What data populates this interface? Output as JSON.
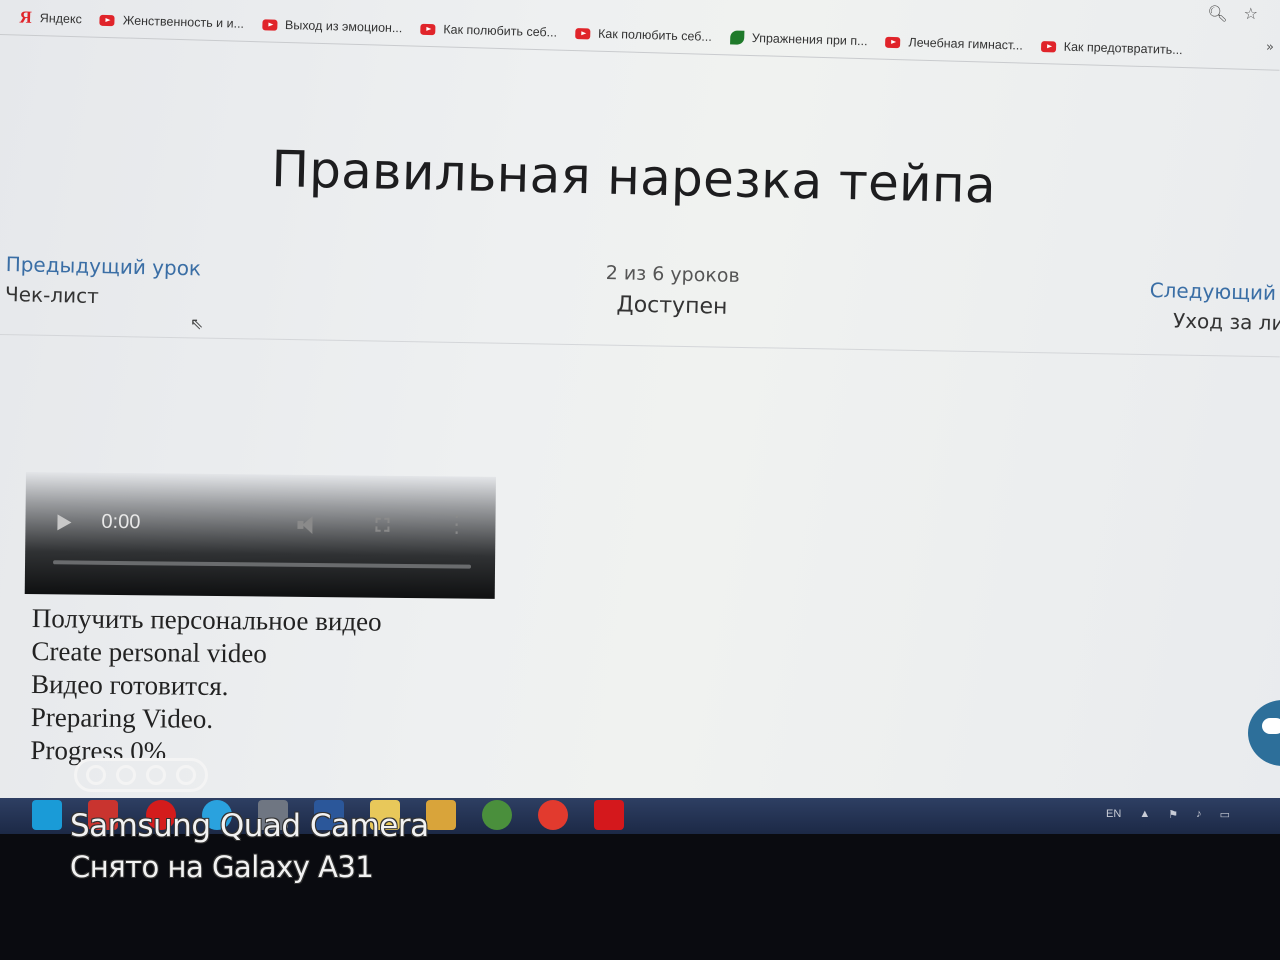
{
  "bookmarks": [
    {
      "label": "Яндекс",
      "icon": "yandex-icon"
    },
    {
      "label": "Женственность и и...",
      "icon": "youtube-icon"
    },
    {
      "label": "Выход из эмоцион...",
      "icon": "youtube-icon"
    },
    {
      "label": "Как полюбить себ...",
      "icon": "youtube-icon"
    },
    {
      "label": "Как полюбить себ...",
      "icon": "youtube-icon"
    },
    {
      "label": "Упражнения при п...",
      "icon": "leaf-icon"
    },
    {
      "label": "Лечебная гимнаст...",
      "icon": "youtube-icon"
    },
    {
      "label": "Как предотвратить...",
      "icon": "youtube-icon"
    }
  ],
  "bookmarks_more": "»",
  "lesson": {
    "title": "Правильная нарезка тейпа",
    "prev_label": "Предыдущий урок",
    "prev_title": "Чек-лист",
    "count": "2 из 6 уроков",
    "status": "Доступен",
    "next_label": "Следующий у",
    "next_title": "Уход за ли"
  },
  "video": {
    "time": "0:00"
  },
  "text_lines": [
    "Получить персональное видео",
    "Create personal video",
    "Видео готовится.",
    "Preparing Video.",
    "Progress 0%"
  ],
  "tray": {
    "lang": "EN"
  },
  "camera_overlay": {
    "title": "Samsung Quad Camera",
    "subtitle": "Снято на Galaxy A31"
  },
  "colors": {
    "link": "#3a6ea5",
    "youtube": "#e0242a",
    "taskbar": "#1c2946"
  }
}
